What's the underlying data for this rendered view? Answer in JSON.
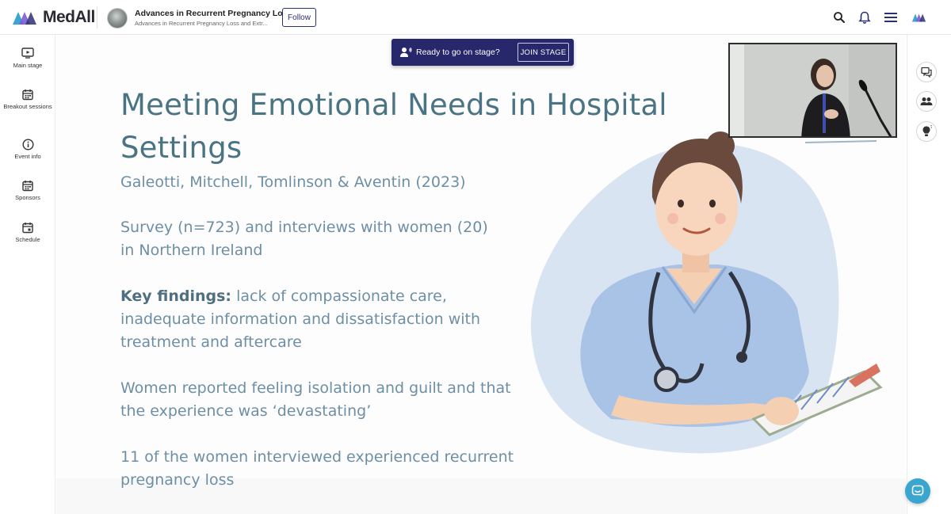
{
  "app": {
    "brand_name": "MedAll",
    "brand_colors": {
      "primary": "#2b2f73",
      "accent_blue": "#3aa6d0",
      "accent_purple": "#7d5bd6"
    }
  },
  "header": {
    "event_title": "Advances in Recurrent Pregnancy Lo...",
    "event_subtitle": "Advances in Recurrent Pregnancy Loss and Extr...",
    "follow_label": "Follow",
    "icons": [
      "search-icon",
      "bell-icon",
      "menu-icon",
      "medall-logo-icon"
    ]
  },
  "sidebar": {
    "items": [
      {
        "icon": "play-screen-icon",
        "label": "Main stage"
      },
      {
        "icon": "calendar-icon",
        "label": "Breakout sessions"
      },
      {
        "icon": "info-icon",
        "label": "Event info"
      },
      {
        "icon": "calendar-icon",
        "label": "Sponsors"
      },
      {
        "icon": "calendar-check-icon",
        "label": "Schedule"
      }
    ]
  },
  "stage_banner": {
    "icon": "speaker-icon",
    "text": "Ready to go on stage?",
    "join_label": "JOIN STAGE"
  },
  "slide": {
    "title": "Meeting Emotional Needs in Hospital Settings",
    "citation": "Galeotti, Mitchell, Tomlinson & Aventin (2023)",
    "survey": "Survey (n=723) and interviews with women (20) in Northern Ireland",
    "key_label": "Key findings:",
    "key_text": " lack of compassionate care, inadequate information and dissatisfaction with treatment and aftercare",
    "reported": "Women reported feeling isolation and guilt and that the experience was ‘devastating’",
    "recurrent": "11 of the women interviewed experienced recurrent pregnancy loss"
  },
  "right_rail": {
    "buttons": [
      "chat-icon",
      "people-icon",
      "lightbulb-icon"
    ]
  },
  "chat_fab": {
    "icon": "message-icon"
  }
}
